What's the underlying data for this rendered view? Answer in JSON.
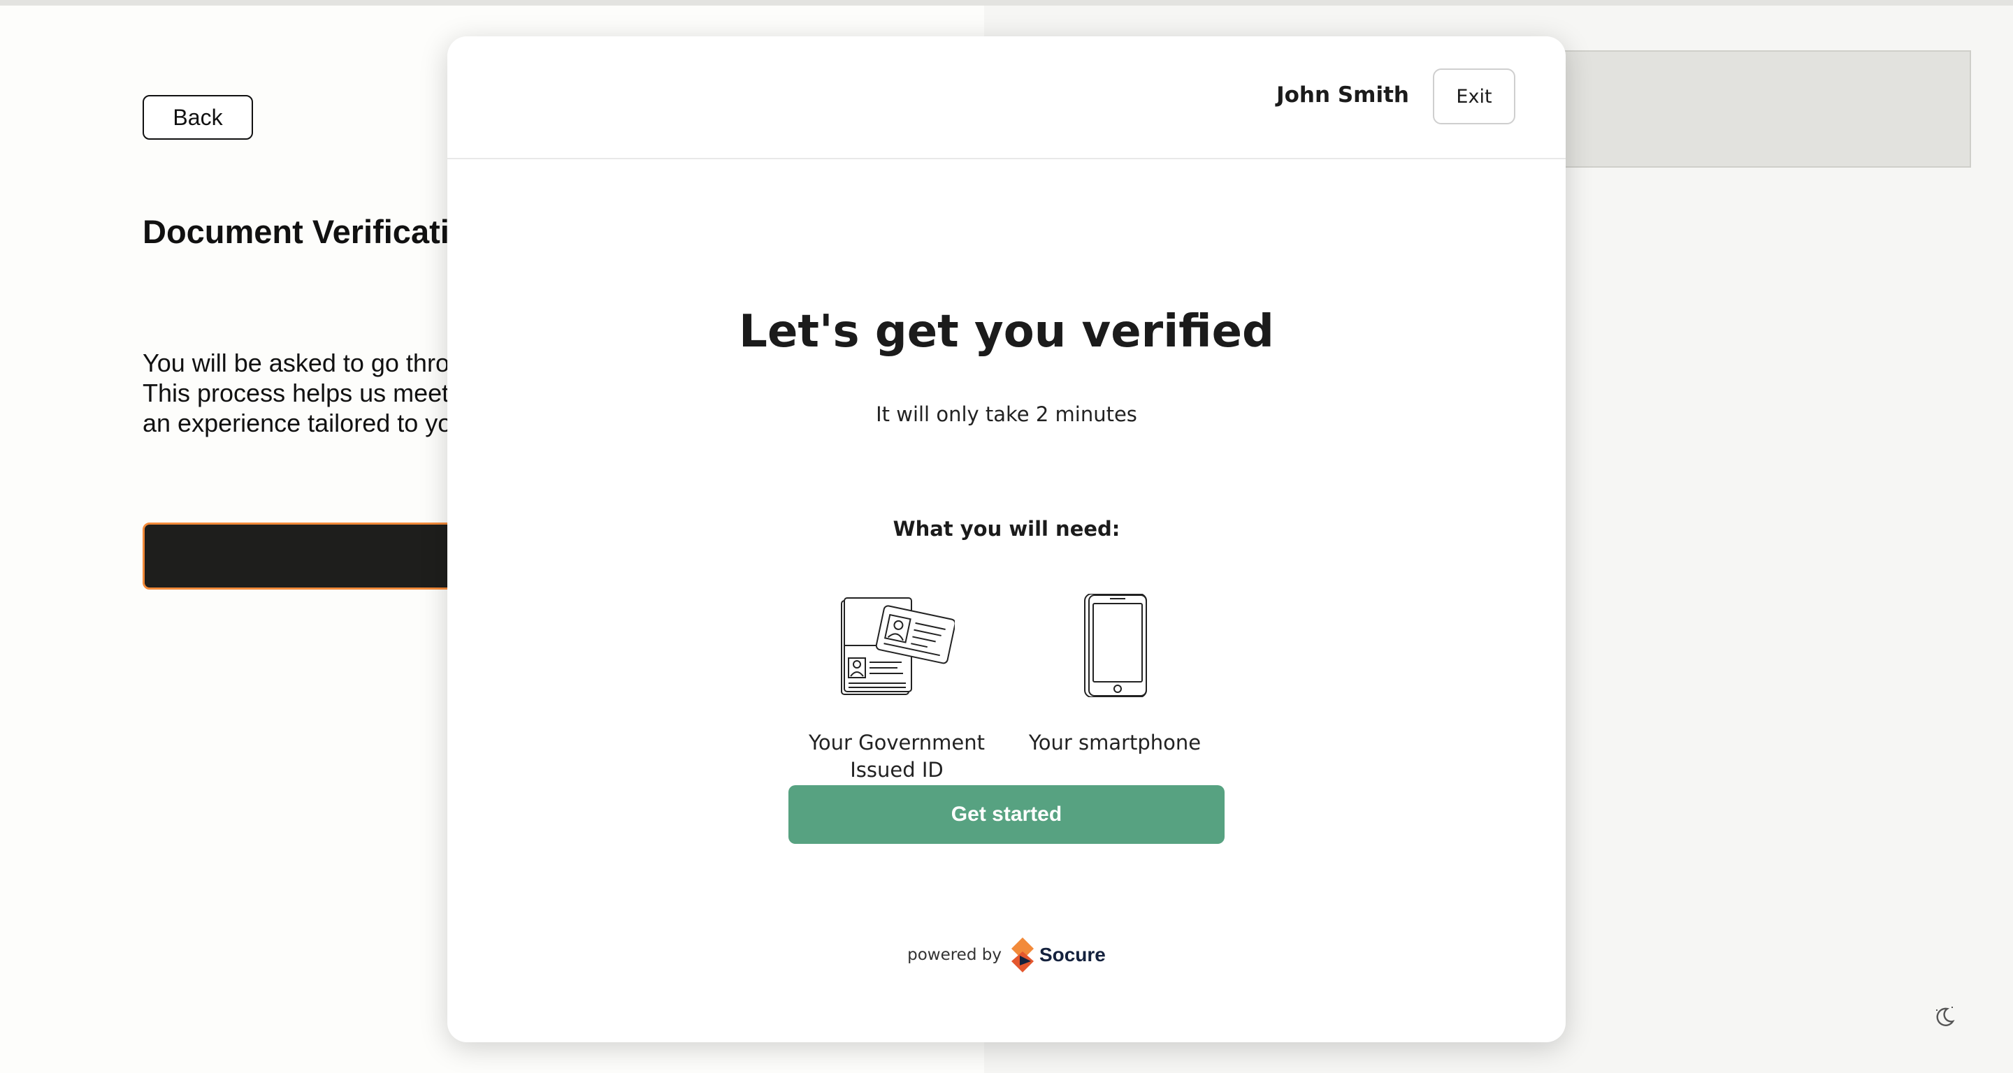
{
  "background": {
    "back_label": "Back",
    "title": "Document Verification",
    "description": "You will be asked to go through a verification of your identity. This process helps us meet compliance standards and provide an experience tailored to you."
  },
  "modal": {
    "user_name": "John Smith",
    "exit_label": "Exit",
    "title": "Let's get you verified",
    "subtitle": "It will only take 2 minutes",
    "need_heading": "What you will need:",
    "items": [
      {
        "label": "Your Government Issued ID",
        "icon": "id-documents-icon"
      },
      {
        "label": "Your smartphone",
        "icon": "smartphone-icon"
      }
    ],
    "cta_label": "Get started",
    "powered_by": "powered by",
    "brand": "Socure"
  },
  "colors": {
    "cta": "#57a281",
    "accent_orange": "#f28a3a",
    "dark_button": "#1e1e1c",
    "brand_navy": "#14213d"
  }
}
